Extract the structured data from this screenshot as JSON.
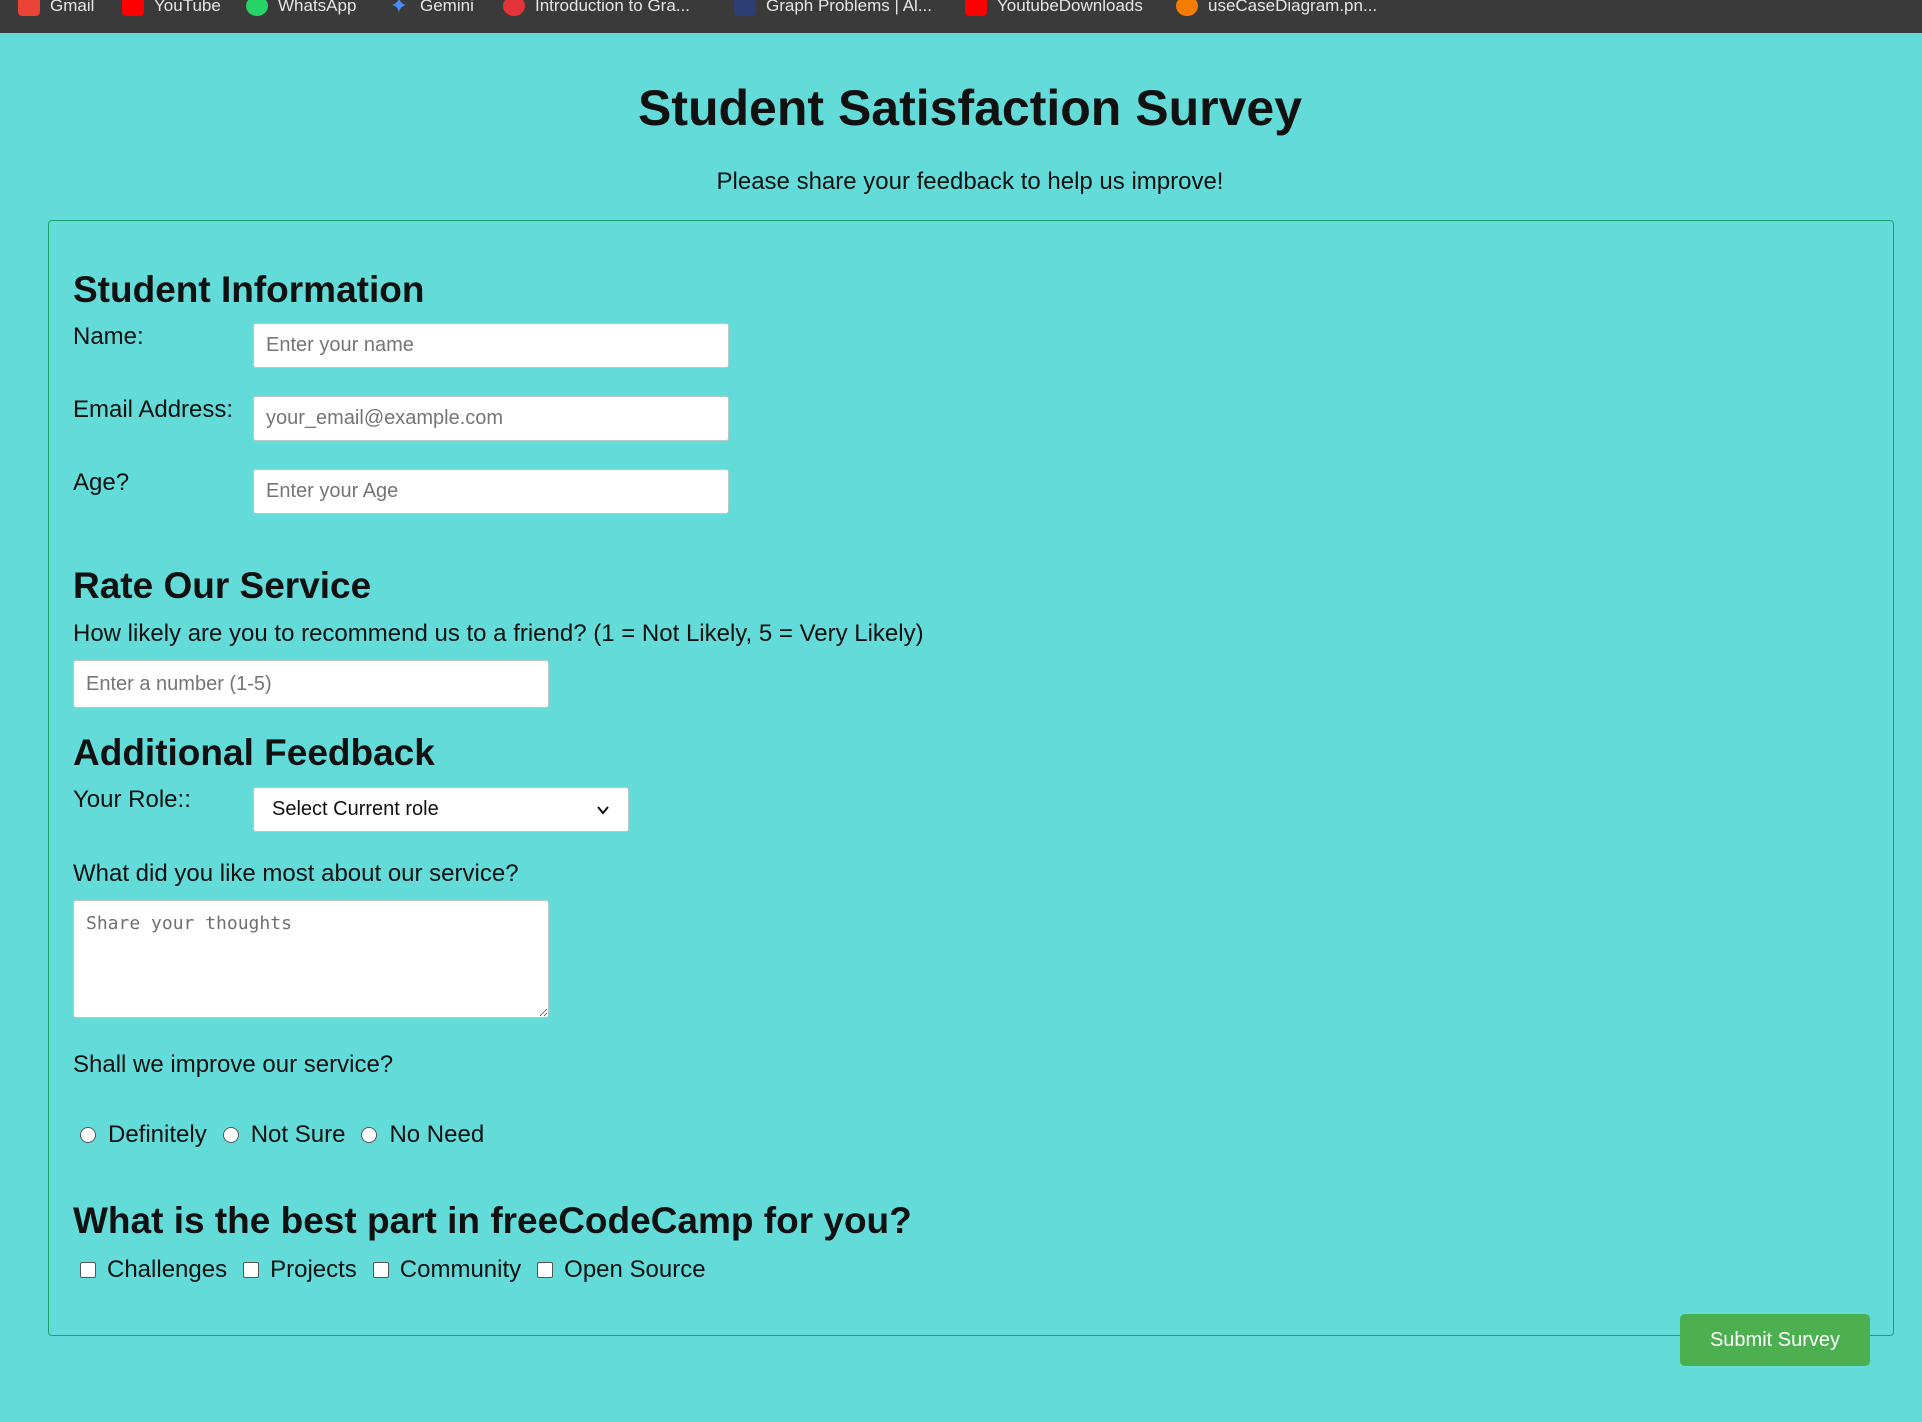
{
  "bookmarks": [
    {
      "label": "Gmail",
      "icon": "gmail-icon",
      "color": "#ea4335"
    },
    {
      "label": "YouTube",
      "icon": "youtube-icon",
      "color": "#ff0000"
    },
    {
      "label": "WhatsApp",
      "icon": "whatsapp-icon",
      "color": "#25d366"
    },
    {
      "label": "Gemini",
      "icon": "gemini-icon",
      "color": "#4b8bf5"
    },
    {
      "label": "Introduction to Gra...",
      "icon": "site-icon",
      "color": "#e5333a"
    },
    {
      "label": "Graph Problems | Al...",
      "icon": "site-icon",
      "color": "#2c3e73"
    },
    {
      "label": "YoutubeDownloads",
      "icon": "youtube-icon",
      "color": "#ff0000"
    },
    {
      "label": "useCaseDiagram.pn...",
      "icon": "site-icon",
      "color": "#f57c00"
    }
  ],
  "header": {
    "title": "Student Satisfaction Survey",
    "description": "Please share your feedback to help us improve!"
  },
  "student_info": {
    "heading": "Student Information",
    "name_label": "Name:",
    "name_placeholder": "Enter your name",
    "email_label": "Email Address:",
    "email_placeholder": "your_email@example.com",
    "age_label": "Age?",
    "age_placeholder": "Enter your Age"
  },
  "rating": {
    "heading": "Rate Our Service",
    "question": "How likely are you to recommend us to a friend? (1 = Not Likely, 5 = Very Likely)",
    "placeholder": "Enter a number (1-5)"
  },
  "feedback": {
    "heading": "Additional Feedback",
    "role_label": "Your Role::",
    "role_selected": "Select Current role",
    "liked_question": "What did you like most about our service?",
    "liked_placeholder": "Share your thoughts",
    "improve_question": "Shall we improve our service?",
    "improve_options": [
      "Definitely",
      "Not Sure",
      "No Need"
    ]
  },
  "best_part": {
    "heading": "What is the best part in freeCodeCamp for you?",
    "options": [
      "Challenges",
      "Projects",
      "Community",
      "Open Source"
    ]
  },
  "submit_label": "Submit Survey",
  "colors": {
    "page_background": "#63dcd9",
    "form_border": "#1aa36a",
    "submit_button": "#4caf50"
  }
}
